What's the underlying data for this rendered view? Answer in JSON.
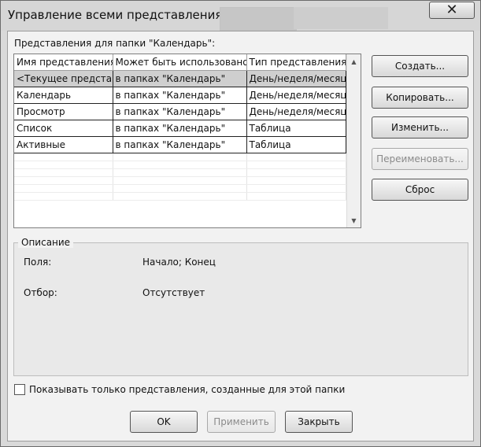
{
  "window": {
    "title": "Управление всеми представлениями",
    "close_glyph": "✕"
  },
  "folder_label": "Представления для папки \"Календарь\":",
  "table": {
    "columns": [
      "Имя представления",
      "Может быть использовано",
      "Тип представления"
    ],
    "rows": [
      [
        "<Текущее предста...",
        "в папках \"Календарь\"",
        "День/неделя/месяц"
      ],
      [
        "Календарь",
        "в папках \"Календарь\"",
        "День/неделя/месяц"
      ],
      [
        "Просмотр",
        "в папках \"Календарь\"",
        "День/неделя/месяц"
      ],
      [
        "Список",
        "в папках \"Календарь\"",
        "Таблица"
      ],
      [
        "Активные",
        "в папках \"Календарь\"",
        "Таблица"
      ]
    ],
    "selected_row": 0
  },
  "side_buttons": {
    "create": "Создать...",
    "copy": "Копировать...",
    "modify": "Изменить...",
    "rename": "Переименовать...",
    "reset": "Сброс"
  },
  "description": {
    "legend": "Описание",
    "fields_label": "Поля:",
    "fields_value": "Начало; Конец",
    "filter_label": "Отбор:",
    "filter_value": "Отсутствует"
  },
  "checkbox": {
    "label": "Показывать только представления, созданные для этой папки",
    "checked": false
  },
  "bottom_buttons": {
    "ok": "OK",
    "apply": "Применить",
    "close": "Закрыть"
  },
  "icons": [
    "close-icon",
    "scroll-up-arrow-icon",
    "scroll-down-arrow-icon"
  ]
}
